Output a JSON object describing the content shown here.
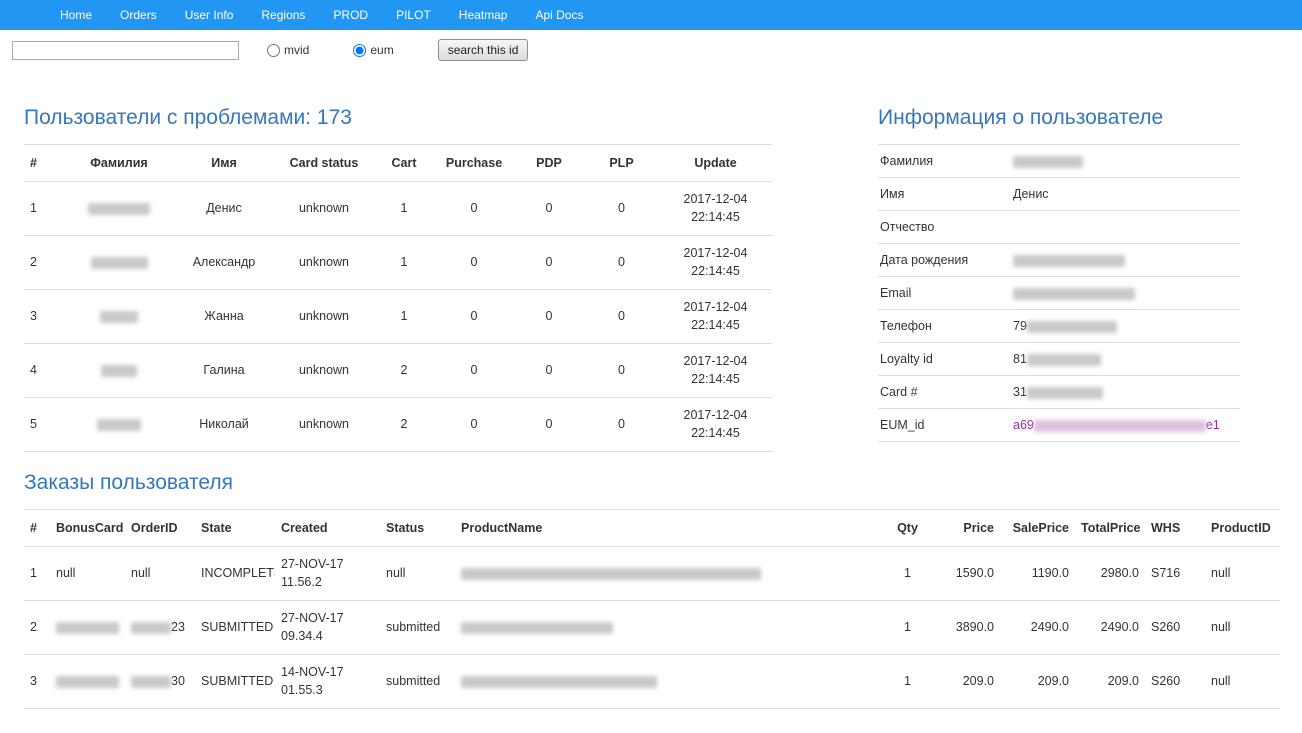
{
  "colors": {
    "nav_background": "#2196f3",
    "section_title": "#3477bb",
    "eum_link": "#9c27b0"
  },
  "nav": {
    "items": [
      "Home",
      "Orders",
      "User Info",
      "Regions",
      "PROD",
      "PILOT",
      "Heatmap",
      "Api Docs"
    ]
  },
  "search": {
    "input_value": "",
    "radios": [
      {
        "label": "mvid",
        "checked": false
      },
      {
        "label": "eum",
        "checked": true
      }
    ],
    "eum_checked_attr": "checked",
    "button_label": "search this id"
  },
  "problem_users": {
    "title": "Пользователи с проблемами: 173",
    "columns": [
      "#",
      "Фамилия",
      "Имя",
      "Card status",
      "Cart",
      "Purchase",
      "PDP",
      "PLP",
      "Update"
    ],
    "rows": [
      {
        "num": "1",
        "surname_redacted": true,
        "name": "Денис",
        "card_status": "unknown",
        "cart": "1",
        "purchase": "0",
        "pdp": "0",
        "plp": "0",
        "update_date": "2017-12-04",
        "update_time": "22:14:45"
      },
      {
        "num": "2",
        "surname_redacted": true,
        "name": "Александр",
        "card_status": "unknown",
        "cart": "1",
        "purchase": "0",
        "pdp": "0",
        "plp": "0",
        "update_date": "2017-12-04",
        "update_time": "22:14:45"
      },
      {
        "num": "3",
        "surname_redacted": true,
        "name": "Жанна",
        "card_status": "unknown",
        "cart": "1",
        "purchase": "0",
        "pdp": "0",
        "plp": "0",
        "update_date": "2017-12-04",
        "update_time": "22:14:45"
      },
      {
        "num": "4",
        "surname_redacted": true,
        "name": "Галина",
        "card_status": "unknown",
        "cart": "2",
        "purchase": "0",
        "pdp": "0",
        "plp": "0",
        "update_date": "2017-12-04",
        "update_time": "22:14:45"
      },
      {
        "num": "5",
        "surname_redacted": true,
        "name": "Николай",
        "card_status": "unknown",
        "cart": "2",
        "purchase": "0",
        "pdp": "0",
        "plp": "0",
        "update_date": "2017-12-04",
        "update_time": "22:14:45"
      }
    ]
  },
  "user_info": {
    "title": "Информация о пользователе",
    "fields": [
      {
        "label": "Фамилия",
        "value": "",
        "redacted": true
      },
      {
        "label": "Имя",
        "value": "Денис",
        "redacted": false
      },
      {
        "label": "Отчество",
        "value": "",
        "redacted": false
      },
      {
        "label": "Дата рождения",
        "value": "",
        "redacted": true
      },
      {
        "label": "Email",
        "value": "",
        "redacted": true
      },
      {
        "label": "Телефон",
        "prefix": "79",
        "redacted": true
      },
      {
        "label": "Loyalty id",
        "prefix": "81",
        "redacted": true
      },
      {
        "label": "Card #",
        "prefix": "31",
        "redacted": true
      },
      {
        "label": "EUM_id",
        "prefix": "a69",
        "suffix": "e1",
        "redacted": true
      }
    ]
  },
  "orders": {
    "title": "Заказы пользователя",
    "columns": [
      "#",
      "BonusCard",
      "OrderID",
      "State",
      "Created",
      "Status",
      "ProductName",
      "Qty",
      "Price",
      "SalePrice",
      "TotalPrice",
      "WHS",
      "ProductID"
    ],
    "rows": [
      {
        "num": "1",
        "bonus_card": "null",
        "bonus_redacted": false,
        "order_id": "null",
        "order_redacted": false,
        "order_id_suffix": "",
        "state": "INCOMPLETE",
        "created_date": "27-NOV-17",
        "created_time": "11.56.2",
        "status": "null",
        "product_redacted": true,
        "qty": "1",
        "price": "1590.0",
        "sale_price": "1190.0",
        "total_price": "2980.0",
        "whs": "S716",
        "product_id": "null"
      },
      {
        "num": "2",
        "bonus_card": "",
        "bonus_redacted": true,
        "order_id": "",
        "order_redacted": true,
        "order_id_suffix": "23",
        "state": "SUBMITTED",
        "created_date": "27-NOV-17",
        "created_time": "09.34.4",
        "status": "submitted",
        "product_redacted": true,
        "qty": "1",
        "price": "3890.0",
        "sale_price": "2490.0",
        "total_price": "2490.0",
        "whs": "S260",
        "product_id": "null"
      },
      {
        "num": "3",
        "bonus_card": "",
        "bonus_redacted": true,
        "order_id": "",
        "order_redacted": true,
        "order_id_suffix": "30",
        "state": "SUBMITTED",
        "created_date": "14-NOV-17",
        "created_time": "01.55.3",
        "status": "submitted",
        "product_redacted": true,
        "qty": "1",
        "price": "209.0",
        "sale_price": "209.0",
        "total_price": "209.0",
        "whs": "S260",
        "product_id": "null"
      }
    ]
  }
}
